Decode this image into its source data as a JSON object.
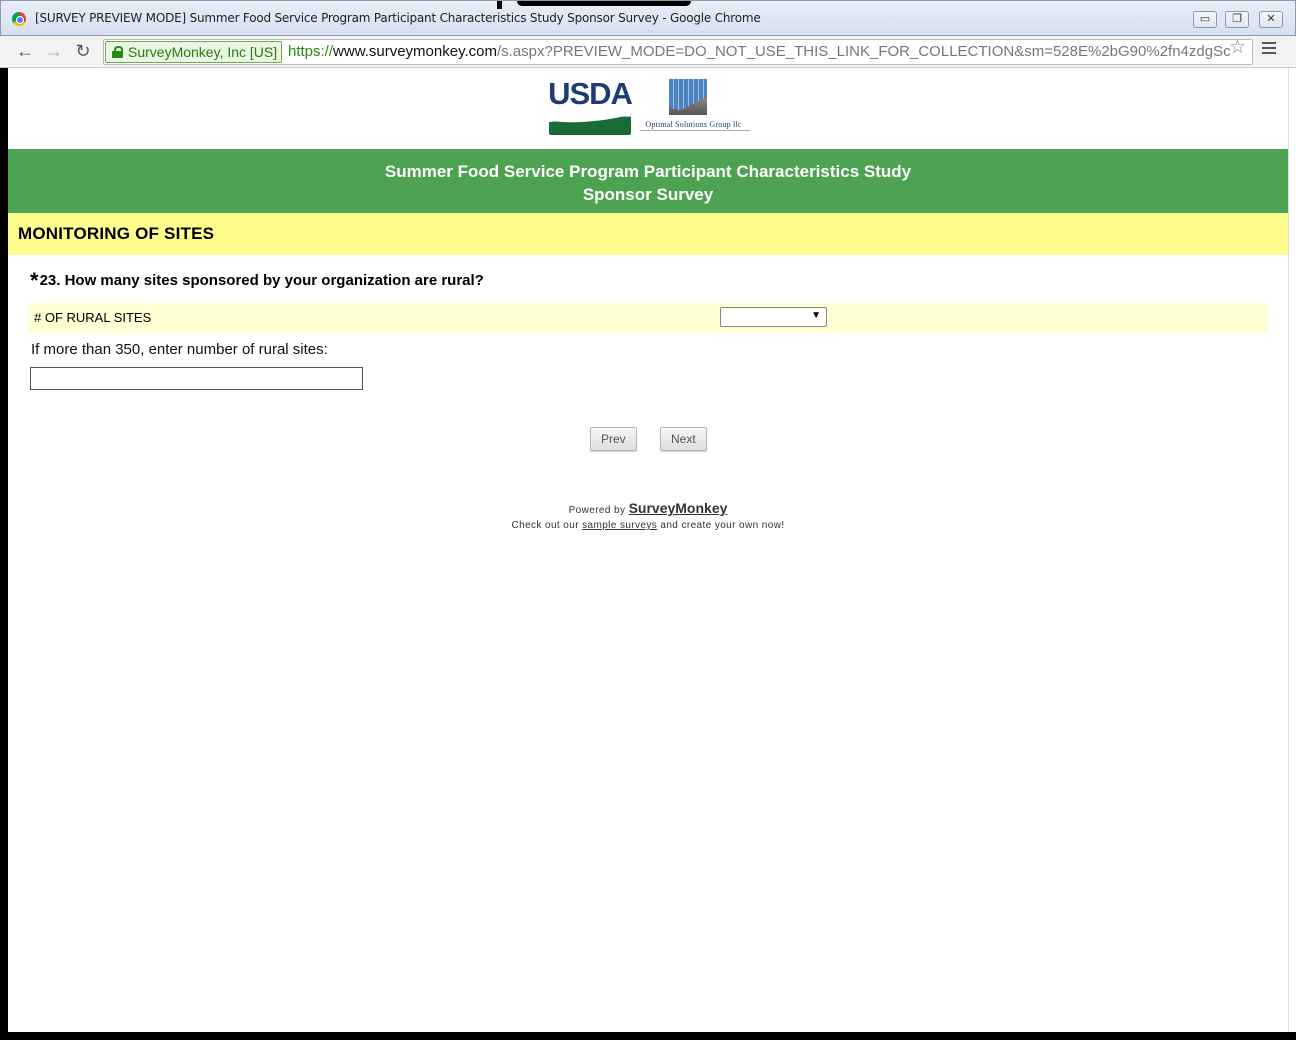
{
  "window": {
    "title": "[SURVEY PREVIEW MODE] Summer Food Service Program Participant Characteristics Study Sponsor Survey - Google Chrome",
    "minimize": "▭",
    "restore": "❐",
    "close": "✕"
  },
  "toolbar": {
    "back_icon": "←",
    "forward_icon": "→",
    "reload_icon": "↻",
    "ev_cert": "SurveyMonkey, Inc [US]",
    "url_scheme": "https://",
    "url_host": "www.surveymonkey.com",
    "url_path": "/s.aspx?PREVIEW_MODE=DO_NOT_USE_THIS_LINK_FOR_COLLECTION&sm=528E%2bG90%2fn4zdgSc",
    "bookmark_icon": "☆"
  },
  "logos": {
    "usda": "USDA",
    "optimal": "Optimal Solutions Group llc"
  },
  "banner": {
    "line1": "Summer Food Service Program Participant Characteristics Study",
    "line2": "Sponsor Survey"
  },
  "section": {
    "title": "MONITORING OF SITES"
  },
  "question": {
    "required_mark": "*",
    "text": "23. How many sites sponsored by your organization are rural?",
    "row_label": "# OF RURAL SITES",
    "select_value": "",
    "select_arrow": "▼",
    "other_label": "If more than 350, enter number of rural sites:",
    "other_value": ""
  },
  "nav": {
    "prev": "Prev",
    "next": "Next"
  },
  "footer": {
    "powered_by": "Powered by ",
    "brand": "SurveyMonkey",
    "check_out": "Check out our ",
    "sample_link": "sample surveys",
    "create": " and create your own now!"
  }
}
